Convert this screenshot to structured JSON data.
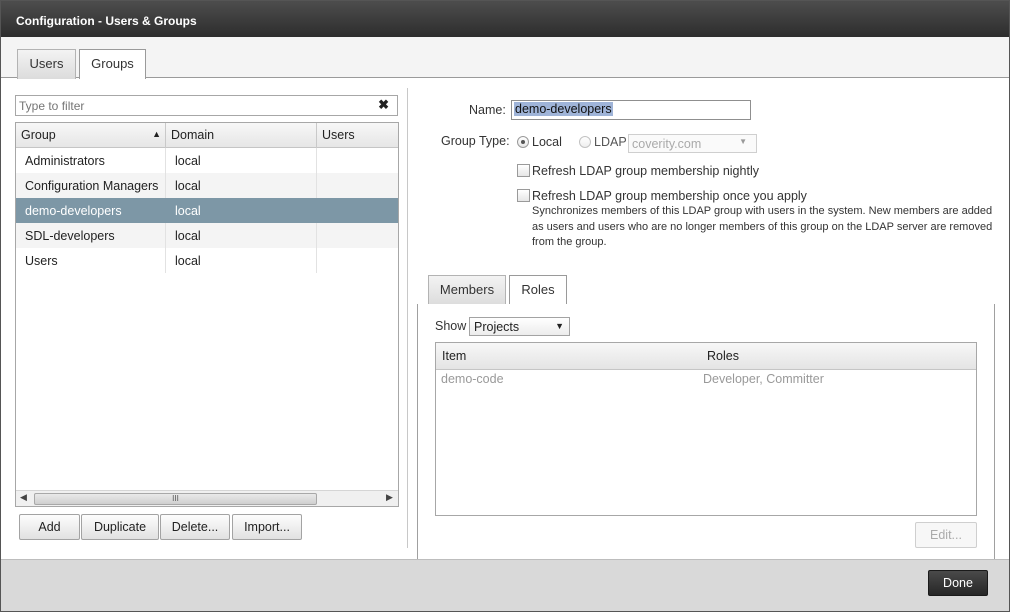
{
  "window": {
    "title": "Configuration - Users & Groups"
  },
  "tabs": [
    {
      "label": "Users"
    },
    {
      "label": "Groups"
    }
  ],
  "filter": {
    "placeholder": "Type to filter",
    "clear_symbol": "✖"
  },
  "groups_table": {
    "columns": [
      "Group",
      "Domain",
      "Users"
    ],
    "sort_indicator": "▲",
    "rows": [
      {
        "group": "Administrators",
        "domain": "local",
        "users": ""
      },
      {
        "group": "Configuration Managers",
        "domain": "local",
        "users": ""
      },
      {
        "group": "demo-developers",
        "domain": "local",
        "users": ""
      },
      {
        "group": "SDL-developers",
        "domain": "local",
        "users": ""
      },
      {
        "group": "Users",
        "domain": "local",
        "users": ""
      }
    ],
    "selected_index": 2,
    "scroll_left": "◀",
    "scroll_right": "▶",
    "scroll_grip": "III"
  },
  "left_buttons": {
    "add": "Add",
    "duplicate": "Duplicate",
    "delete": "Delete...",
    "import": "Import..."
  },
  "details": {
    "name_label": "Name:",
    "name_value": "demo-developers",
    "group_type_label": "Group Type:",
    "local_label": "Local",
    "ldap_label": "LDAP",
    "ldap_server": "coverity.com",
    "refresh_nightly": "Refresh LDAP group membership nightly",
    "refresh_once": "Refresh LDAP group membership once you apply",
    "help_text": "Synchronizes members of this LDAP group with users in the system. New members are added as users and users who are no longer members of this group on the LDAP server are removed from the group."
  },
  "subtabs": [
    {
      "label": "Members"
    },
    {
      "label": "Roles"
    }
  ],
  "roles": {
    "show_label": "Show",
    "show_value": "Projects",
    "columns": [
      "Item",
      "Roles"
    ],
    "rows": [
      {
        "item": "demo-code",
        "roles": "Developer, Committer"
      }
    ],
    "edit_label": "Edit..."
  },
  "footer": {
    "done_label": "Done"
  },
  "colors": {
    "selected_row": "#7d97a6",
    "titlebar": "#3a3a3a",
    "name_highlight": "#9fb4d8"
  }
}
